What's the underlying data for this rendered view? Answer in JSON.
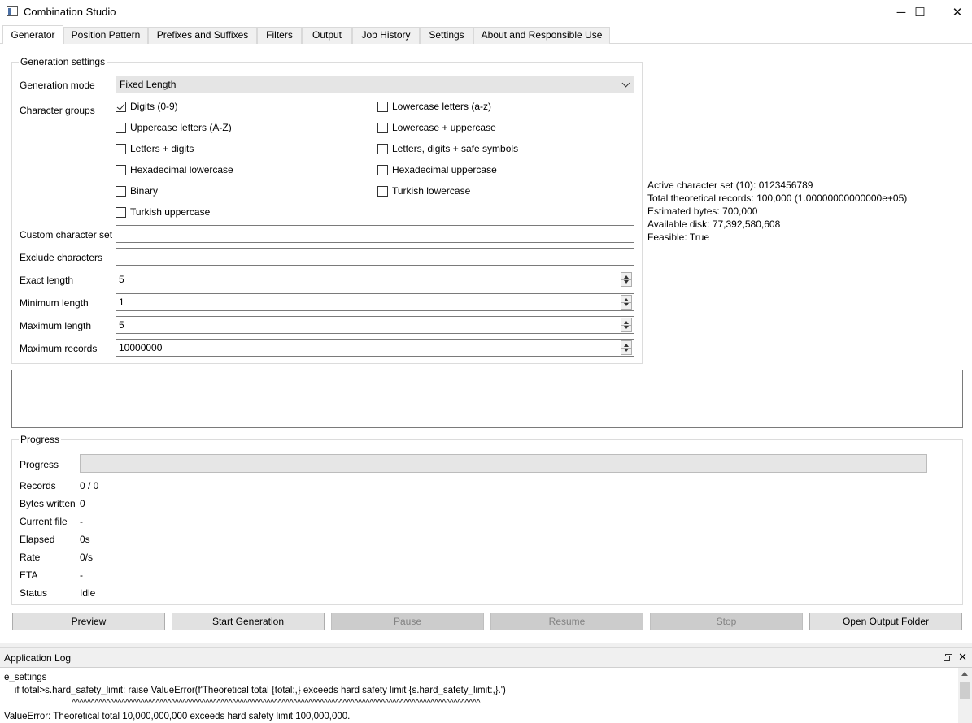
{
  "window": {
    "title": "Combination Studio",
    "minimize": "─",
    "maximize": "☐",
    "close": "✕"
  },
  "tabs": [
    {
      "label": "Generator",
      "active": true
    },
    {
      "label": "Position Pattern"
    },
    {
      "label": "Prefixes and Suffixes"
    },
    {
      "label": "Filters"
    },
    {
      "label": "Output"
    },
    {
      "label": "Job History"
    },
    {
      "label": "Settings"
    },
    {
      "label": "About and Responsible Use"
    }
  ],
  "generation": {
    "group_title": "Generation settings",
    "mode_label": "Generation mode",
    "mode_value": "Fixed Length",
    "groups_label": "Character groups",
    "checkboxes": [
      {
        "label": "Digits (0-9)",
        "checked": true
      },
      {
        "label": "Lowercase letters (a-z)",
        "checked": false
      },
      {
        "label": "Uppercase letters (A-Z)",
        "checked": false
      },
      {
        "label": "Lowercase + uppercase",
        "checked": false
      },
      {
        "label": "Letters + digits",
        "checked": false
      },
      {
        "label": "Letters, digits + safe symbols",
        "checked": false
      },
      {
        "label": "Hexadecimal lowercase",
        "checked": false
      },
      {
        "label": "Hexadecimal uppercase",
        "checked": false
      },
      {
        "label": "Binary",
        "checked": false
      },
      {
        "label": "Turkish lowercase",
        "checked": false
      },
      {
        "label": "Turkish uppercase",
        "checked": false
      }
    ],
    "custom_label": "Custom character set",
    "custom_value": "",
    "exclude_label": "Exclude characters",
    "exclude_value": "",
    "exact_label": "Exact length",
    "exact_value": "5",
    "min_label": "Minimum length",
    "min_value": "1",
    "max_label": "Maximum length",
    "max_value": "5",
    "maxrec_label": "Maximum records",
    "maxrec_value": "10000000"
  },
  "info": {
    "active_set": "Active character set (10): 0123456789",
    "total": "Total theoretical records: 100,000 (1.00000000000000e+05)",
    "bytes": "Estimated bytes: 700,000",
    "disk": "Available disk: 77,392,580,608",
    "feasible": "Feasible: True"
  },
  "progress": {
    "group_title": "Progress",
    "progress_label": "Progress",
    "progress_fraction": 0,
    "records_label": "Records",
    "records_value": "0 / 0",
    "bytes_label": "Bytes written",
    "bytes_value": "0",
    "file_label": "Current file",
    "file_value": "-",
    "elapsed_label": "Elapsed",
    "elapsed_value": "0s",
    "rate_label": "Rate",
    "rate_value": "0/s",
    "eta_label": "ETA",
    "eta_value": "-",
    "status_label": "Status",
    "status_value": "Idle"
  },
  "buttons": {
    "preview": "Preview",
    "start": "Start Generation",
    "pause": "Pause",
    "resume": "Resume",
    "stop": "Stop",
    "open_folder": "Open Output Folder"
  },
  "log": {
    "title": "Application Log",
    "lines": [
      "e_settings",
      "    if total>s.hard_safety_limit: raise ValueError(f'Theoretical total {total:,} exceeds hard safety limit {s.hard_safety_limit:,}.')",
      "                              ^^^^^^^^^^^^^^^^^^^^^^^^^^^^^^^^^^^^^^^^^^^^^^^^^^^^^^^^^^^^^^^^^^^^^^^^^^^^^^^^^^^^^^^^^^^^^^^^^^^^^^^^^^^",
      "ValueError: Theoretical total 10,000,000,000 exceeds hard safety limit 100,000,000."
    ]
  }
}
